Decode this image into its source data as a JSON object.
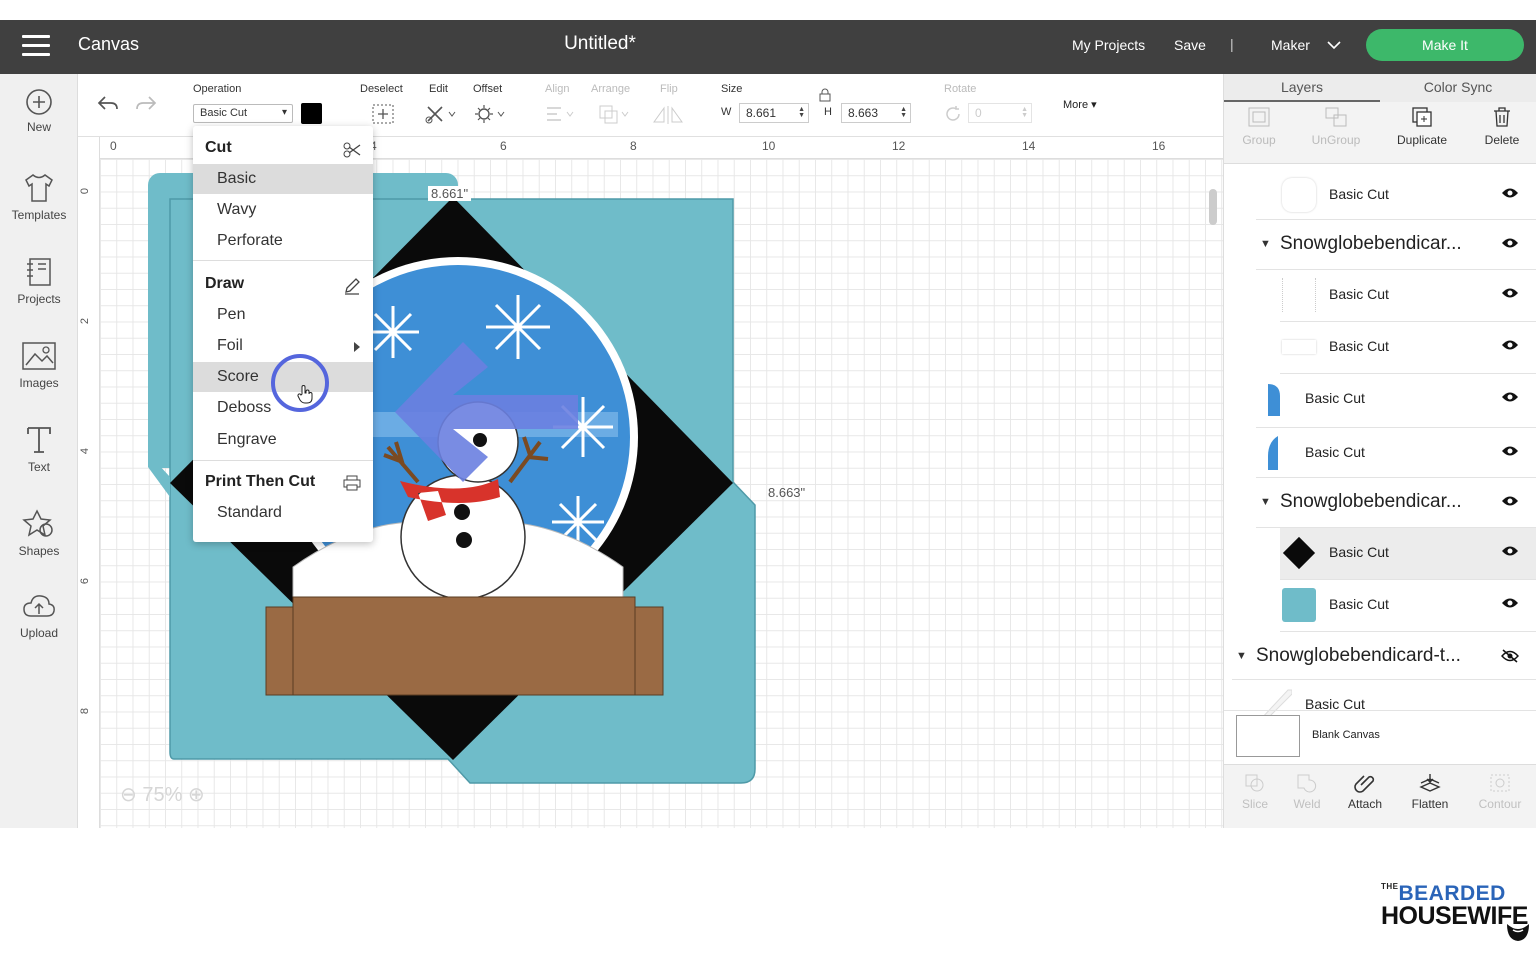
{
  "header": {
    "app_title": "Canvas",
    "doc_title": "Untitled*",
    "my_projects": "My Projects",
    "save": "Save",
    "separator": "|",
    "machine": "Maker",
    "make_it": "Make It",
    "make_it_color": "#3db86a"
  },
  "left_rail": {
    "new": "New",
    "templates": "Templates",
    "projects": "Projects",
    "images": "Images",
    "text": "Text",
    "shapes": "Shapes",
    "upload": "Upload"
  },
  "toolbar": {
    "operation_label": "Operation",
    "operation_value": "Basic Cut",
    "operation_color": "#000000",
    "deselect": "Deselect",
    "edit": "Edit",
    "offset": "Offset",
    "align": "Align",
    "arrange": "Arrange",
    "flip": "Flip",
    "size_label": "Size",
    "w_label": "W",
    "w_value": "8.661",
    "h_label": "H",
    "h_value": "8.663",
    "rotate_label": "Rotate",
    "rotate_value": "0",
    "more": "More"
  },
  "canvas": {
    "ruler_top": [
      "0",
      "2",
      "4",
      "6",
      "8",
      "10",
      "12",
      "14",
      "16"
    ],
    "ruler_left": [
      "0",
      "2",
      "4",
      "6",
      "8",
      "0"
    ],
    "width_label": "8.661\"",
    "height_label": "8.663\"",
    "zoom": "75%"
  },
  "operation_menu": {
    "cut_header": "Cut",
    "cut_items": [
      "Basic",
      "Wavy",
      "Perforate"
    ],
    "draw_header": "Draw",
    "draw_items": [
      "Pen",
      "Foil",
      "Score",
      "Deboss",
      "Engrave"
    ],
    "print_header": "Print Then Cut",
    "print_items": [
      "Standard"
    ],
    "selected": "Basic",
    "hovered": "Score"
  },
  "right_panel": {
    "tab_layers": "Layers",
    "tab_color_sync": "Color Sync",
    "tools": {
      "group": "Group",
      "ungroup": "UnGroup",
      "duplicate": "Duplicate",
      "delete": "Delete"
    },
    "layers": [
      {
        "label": "Basic Cut"
      },
      {
        "label": "Snowglobebendicar..."
      },
      {
        "label": "Basic Cut"
      },
      {
        "label": "Basic Cut"
      },
      {
        "label": "Basic Cut"
      },
      {
        "label": "Basic Cut"
      },
      {
        "label": "Snowglobebendicar..."
      },
      {
        "label": "Basic Cut"
      },
      {
        "label": "Basic Cut"
      },
      {
        "label": "Snowglobebendicard-t..."
      },
      {
        "label": "Basic Cut"
      }
    ],
    "blank_canvas": "Blank Canvas",
    "bottom_tools": {
      "slice": "Slice",
      "weld": "Weld",
      "attach": "Attach",
      "flatten": "Flatten",
      "contour": "Contour"
    }
  },
  "colors": {
    "header_bg": "#404040",
    "card_teal": "#6fbcc9",
    "globe_blue": "#3e8fd6",
    "base_brown": "#9a6a44",
    "arrow": "#6a7fe0"
  },
  "watermark": {
    "small": "THE",
    "top": "BEARDED",
    "bottom": "HOUSEWIFE"
  }
}
